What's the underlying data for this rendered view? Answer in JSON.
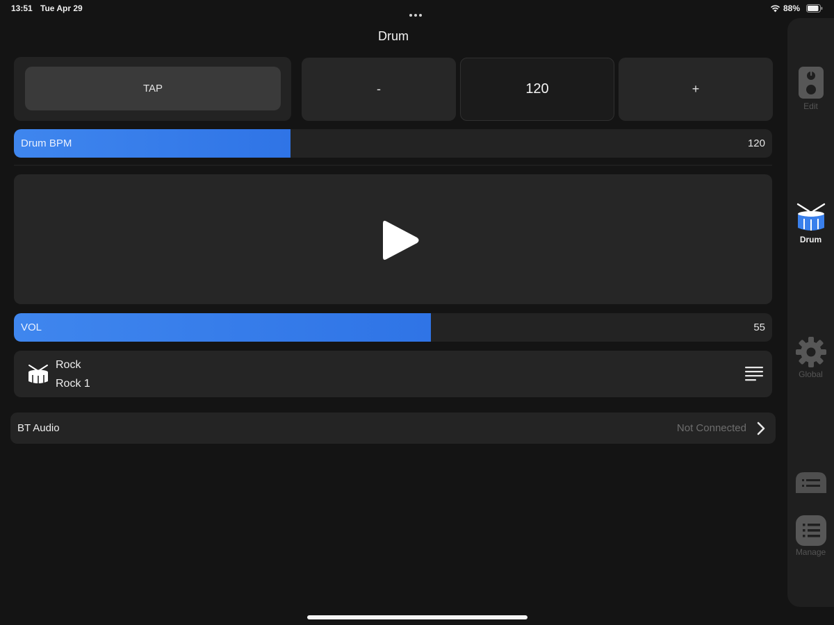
{
  "status_bar": {
    "time": "13:51",
    "date": "Tue Apr 29",
    "battery": "88%"
  },
  "header": {
    "title": "Drum"
  },
  "tempo": {
    "tap_label": "TAP",
    "minus_label": "-",
    "bpm_value": "120",
    "plus_label": "+"
  },
  "bpm_slider": {
    "label": "Drum BPM",
    "value": "120",
    "fill_fraction": 0.365
  },
  "volume_slider": {
    "label": "VOL",
    "value": "55",
    "fill_fraction": 0.55
  },
  "pattern": {
    "genre": "Rock",
    "name": "Rock 1"
  },
  "bt_audio": {
    "label": "BT Audio",
    "status": "Not Connected"
  },
  "sidebar": {
    "tabs": [
      {
        "label": "Edit",
        "active": false,
        "icon": "amp-icon"
      },
      {
        "label": "Drum",
        "active": true,
        "icon": "drum-icon"
      },
      {
        "label": "Global",
        "active": false,
        "icon": "gear-icon"
      },
      {
        "label": "",
        "active": false,
        "icon": "list-icon"
      },
      {
        "label": "Manage",
        "active": false,
        "icon": "manage-icon"
      }
    ]
  },
  "colors": {
    "accent": "#3a80ec",
    "background": "#141414",
    "panel": "#252525"
  }
}
